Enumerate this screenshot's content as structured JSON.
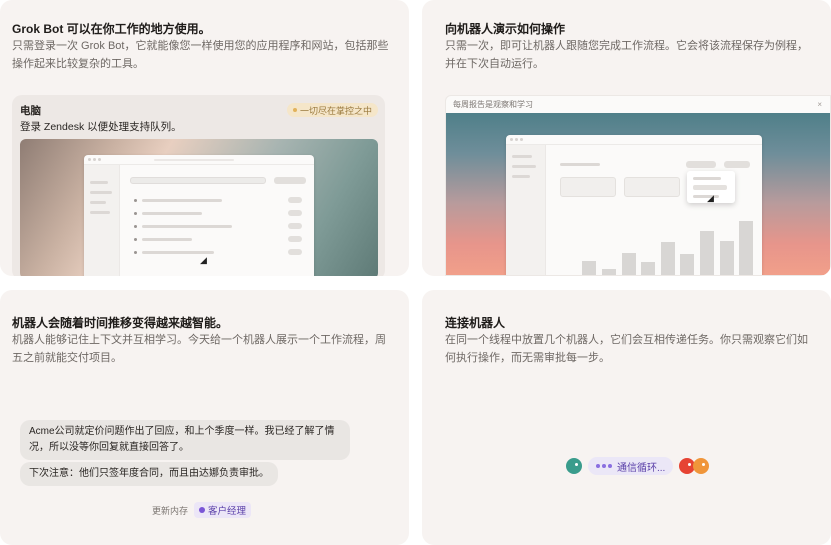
{
  "cards": {
    "grok": {
      "title": "Grok Bot 可以在你工作的地方使用。",
      "desc": "只需登录一次 Grok Bot，它就能像您一样使用您的应用程序和网站，包括那些操作起来比较复杂的工具。",
      "panel": {
        "label": "电脑",
        "task": "登录 Zendesk 以便处理支持队列。",
        "chip": "一切尽在掌控之中"
      }
    },
    "demo": {
      "title": "向机器人演示如何操作",
      "desc": "只需一次，即可让机器人跟随您完成工作流程。它会将该流程保存为例程，并在下次自动运行。",
      "panel": {
        "header": "每周报告是观察和学习",
        "close": "×"
      },
      "chart_bars": [
        0.15,
        0.32,
        0.22,
        0.42,
        0.3,
        0.55,
        0.4,
        0.68,
        0.56,
        0.8
      ]
    },
    "smart": {
      "title": "机器人会随着时间推移变得越来越智能。",
      "desc": "机器人能够记住上下文并互相学习。今天给一个机器人展示一个工作流程，周五之前就能交付项目。",
      "messages": [
        "Acme公司就定价问题作出了回应，和上个季度一样。我已经了解了情况，所以没等你回复就直接回答了。",
        "下次注意：他们只签年度合同，而且由达娜负责审批。"
      ],
      "memory_label": "更新内存",
      "memory_tag": "客户经理"
    },
    "connect": {
      "title": "连接机器人",
      "desc": "在同一个线程中放置几个机器人，它们会互相传递任务。你只需观察它们如何执行操作，而无需审批每一步。",
      "loop_label": "通信循环..."
    }
  },
  "colors": {
    "card_bg": "#f7f3f1",
    "accent_purple": "#7a55d6",
    "chip_bg": "#f5e6c9",
    "bot_teal": "#3a9c8c",
    "bot_red": "#e64333",
    "bot_orange": "#f0953a"
  }
}
